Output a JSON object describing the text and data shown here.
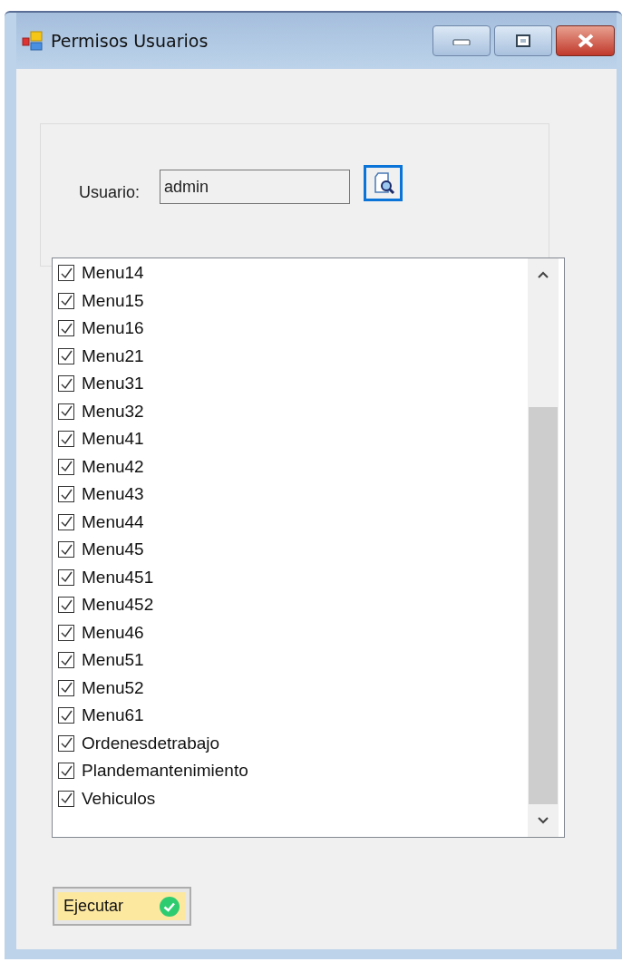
{
  "window": {
    "title": "Permisos Usuarios"
  },
  "user": {
    "label": "Usuario:",
    "value": "admin"
  },
  "permissions": [
    {
      "label": "Menu14",
      "checked": true
    },
    {
      "label": "Menu15",
      "checked": true
    },
    {
      "label": "Menu16",
      "checked": true
    },
    {
      "label": "Menu21",
      "checked": true
    },
    {
      "label": "Menu31",
      "checked": true
    },
    {
      "label": "Menu32",
      "checked": true
    },
    {
      "label": "Menu41",
      "checked": true
    },
    {
      "label": "Menu42",
      "checked": true
    },
    {
      "label": "Menu43",
      "checked": true
    },
    {
      "label": "Menu44",
      "checked": true
    },
    {
      "label": "Menu45",
      "checked": true
    },
    {
      "label": "Menu451",
      "checked": true
    },
    {
      "label": "Menu452",
      "checked": true
    },
    {
      "label": "Menu46",
      "checked": true
    },
    {
      "label": "Menu51",
      "checked": true
    },
    {
      "label": "Menu52",
      "checked": true
    },
    {
      "label": "Menu61",
      "checked": true
    },
    {
      "label": "Ordenesdetrabajo",
      "checked": true
    },
    {
      "label": "Plandemantenimiento",
      "checked": true
    },
    {
      "label": "Vehiculos",
      "checked": true
    }
  ],
  "buttons": [
    {
      "label": "Ejecutar"
    }
  ]
}
